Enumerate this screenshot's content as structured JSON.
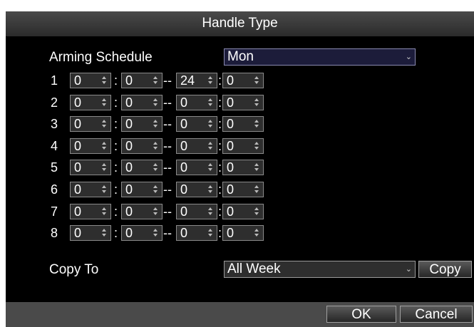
{
  "dialog": {
    "title": "Handle Type"
  },
  "schedule": {
    "label": "Arming Schedule",
    "day": "Mon"
  },
  "rows": [
    {
      "num": "1",
      "start_h": "0",
      "start_m": "0",
      "end_h": "24",
      "end_m": "0"
    },
    {
      "num": "2",
      "start_h": "0",
      "start_m": "0",
      "end_h": "0",
      "end_m": "0"
    },
    {
      "num": "3",
      "start_h": "0",
      "start_m": "0",
      "end_h": "0",
      "end_m": "0"
    },
    {
      "num": "4",
      "start_h": "0",
      "start_m": "0",
      "end_h": "0",
      "end_m": "0"
    },
    {
      "num": "5",
      "start_h": "0",
      "start_m": "0",
      "end_h": "0",
      "end_m": "0"
    },
    {
      "num": "6",
      "start_h": "0",
      "start_m": "0",
      "end_h": "0",
      "end_m": "0"
    },
    {
      "num": "7",
      "start_h": "0",
      "start_m": "0",
      "end_h": "0",
      "end_m": "0"
    },
    {
      "num": "8",
      "start_h": "0",
      "start_m": "0",
      "end_h": "0",
      "end_m": "0"
    }
  ],
  "separators": {
    "colon": ":",
    "dash": "--"
  },
  "copy": {
    "label": "Copy To",
    "target": "All Week",
    "button": "Copy"
  },
  "footer": {
    "ok": "OK",
    "cancel": "Cancel"
  },
  "icons": {
    "dropdown": "chevron-down-icon",
    "spinner": "up-down-arrows-icon"
  }
}
